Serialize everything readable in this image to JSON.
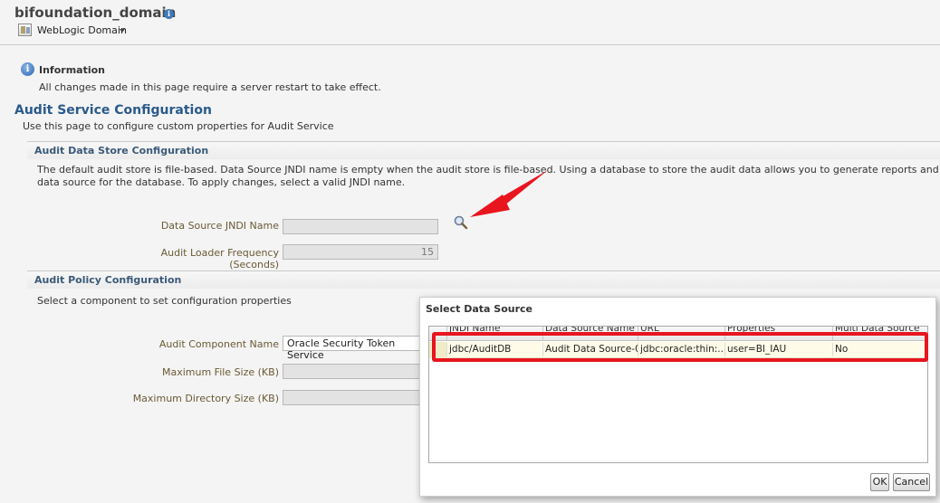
{
  "header": {
    "domain_title": "bifoundation_domain",
    "menu_label": "WebLogic Domain"
  },
  "info": {
    "title": "Information",
    "text": "All changes made in this page require a server restart to take effect."
  },
  "page": {
    "title": "Audit Service Configuration",
    "subtitle": "Use this page to configure custom properties for Audit Service"
  },
  "data_store": {
    "section_title": "Audit Data Store Configuration",
    "description_line1": "The default audit store is file-based. Data Source JNDI name is empty when the audit store is file-based. Using a database to store the audit data allows you to generate reports and analyze the audit data r",
    "description_line2": "data source for the database. To apply changes, select a valid JNDI name.",
    "jndi_label": "Data Source JNDI Name",
    "jndi_value": "",
    "frequency_label": "Audit Loader Frequency (Seconds)",
    "frequency_value": "15"
  },
  "policy": {
    "section_title": "Audit Policy Configuration",
    "description": "Select a component to set configuration properties",
    "component_label": "Audit Component Name",
    "component_value": "Oracle Security Token Service",
    "max_file_label": "Maximum File Size (KB)",
    "max_dir_label": "Maximum Directory Size (KB)"
  },
  "dialog": {
    "title": "Select Data Source",
    "columns": [
      "JNDI Name",
      "Data Source Name",
      "URL",
      "Properties",
      "Multi Data Source"
    ],
    "rows": [
      [
        "jdbc/AuditDB",
        "Audit Data Source-0",
        "jdbc:oracle:thin:...",
        "user=BI_IAU",
        "No"
      ]
    ],
    "ok_label": "OK",
    "cancel_label": "Cancel"
  },
  "colors": {
    "highlight": "#e8151e",
    "title_blue": "#2a5a8c"
  }
}
